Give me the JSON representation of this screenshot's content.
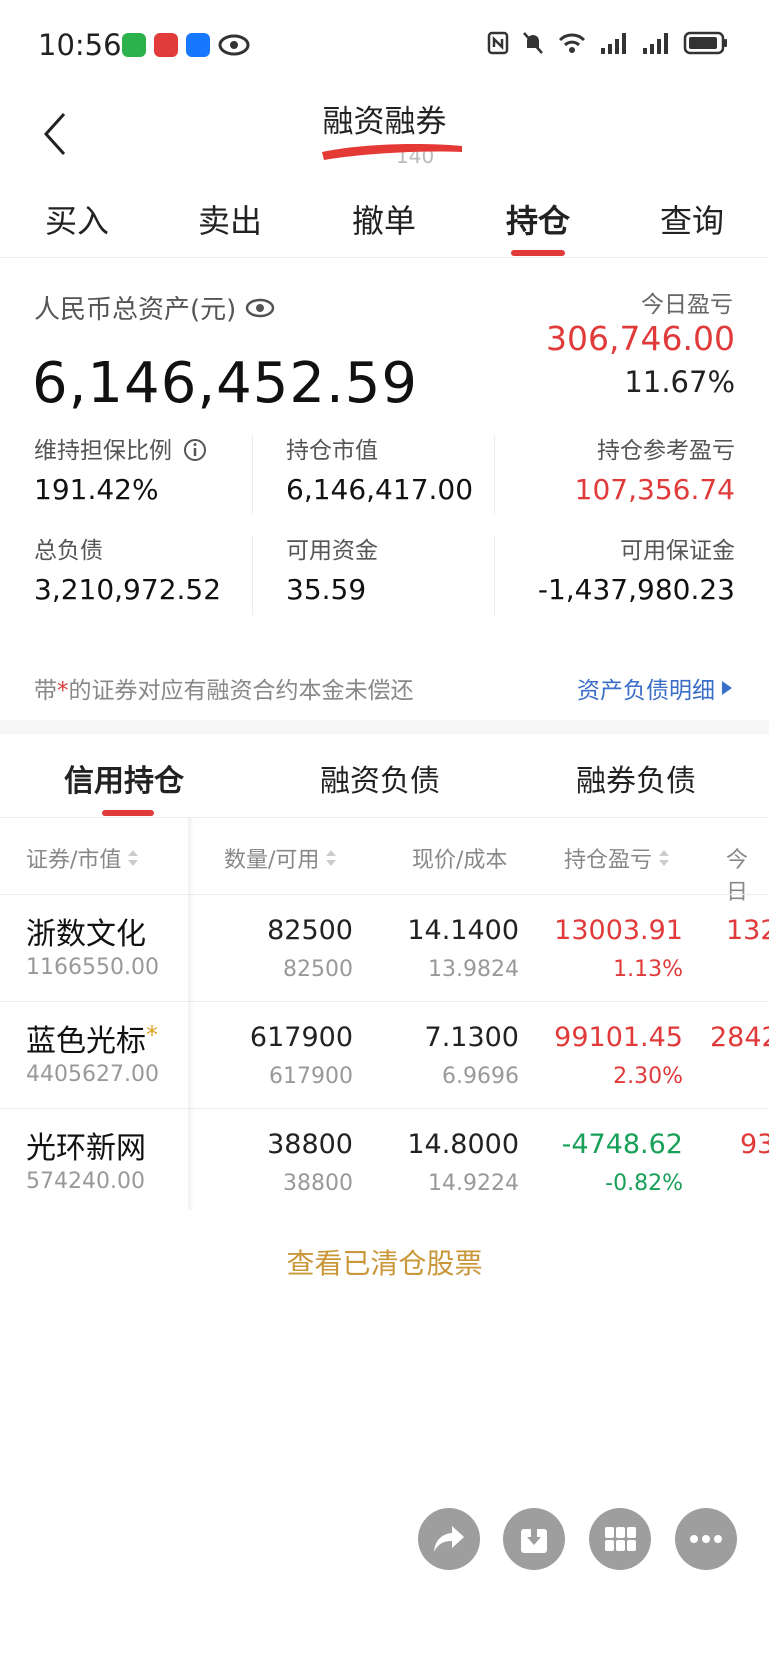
{
  "status": {
    "time": "10:56"
  },
  "header": {
    "title": "融资融券",
    "partial_text": "140"
  },
  "top_tabs": [
    {
      "label": "买入"
    },
    {
      "label": "卖出"
    },
    {
      "label": "撤单"
    },
    {
      "label": "持仓",
      "active": true
    },
    {
      "label": "查询"
    }
  ],
  "assets": {
    "total_label": "人民币总资产(元)",
    "total_value": "6,146,452.59",
    "today_label": "今日盈亏",
    "today_value": "306,746.00",
    "today_pct": "11.67%",
    "metrics": [
      {
        "label": "维持担保比例",
        "value": "191.42%"
      },
      {
        "label": "持仓市值",
        "value": "6,146,417.00"
      },
      {
        "label": "持仓参考盈亏",
        "value": "107,356.74"
      },
      {
        "label": "总负债",
        "value": "3,210,972.52"
      },
      {
        "label": "可用资金",
        "value": "35.59"
      },
      {
        "label": "可用保证金",
        "value": "-1,437,980.23"
      }
    ],
    "footnote_prefix": "带",
    "footnote_star": "*",
    "footnote_suffix": "的证券对应有融资合约本金未偿还",
    "detail_link": "资产负债明细"
  },
  "sub_tabs": [
    {
      "label": "信用持仓",
      "active": true
    },
    {
      "label": "融资负债"
    },
    {
      "label": "融券负债"
    }
  ],
  "table": {
    "headers": [
      "证券/市值",
      "数量/可用",
      "现价/成本",
      "持仓盈亏",
      "今日"
    ],
    "rows": [
      {
        "name": "浙数文化",
        "star": "",
        "market_value": "1166550.00",
        "qty": "82500",
        "avail": "82500",
        "price": "14.1400",
        "cost": "13.9824",
        "pnl": "13003.91",
        "pnl_pct": "1.13%",
        "today": "132"
      },
      {
        "name": "蓝色光标",
        "star": "*",
        "market_value": "4405627.00",
        "qty": "617900",
        "avail": "617900",
        "price": "7.1300",
        "cost": "6.9696",
        "pnl": "99101.45",
        "pnl_pct": "2.30%",
        "today": "2842"
      },
      {
        "name": "光环新网",
        "star": "",
        "market_value": "574240.00",
        "qty": "38800",
        "avail": "38800",
        "price": "14.8000",
        "cost": "14.9224",
        "pnl": "-4748.62",
        "pnl_pct": "-0.82%",
        "today": "93"
      }
    ]
  },
  "view_cleared": "查看已清仓股票",
  "colors": {
    "accent_red": "#e03a3a",
    "gain_red": "#e03a3a",
    "loss_green": "#18a058",
    "link_blue": "#3a6ec9",
    "gold": "#c9973a"
  }
}
